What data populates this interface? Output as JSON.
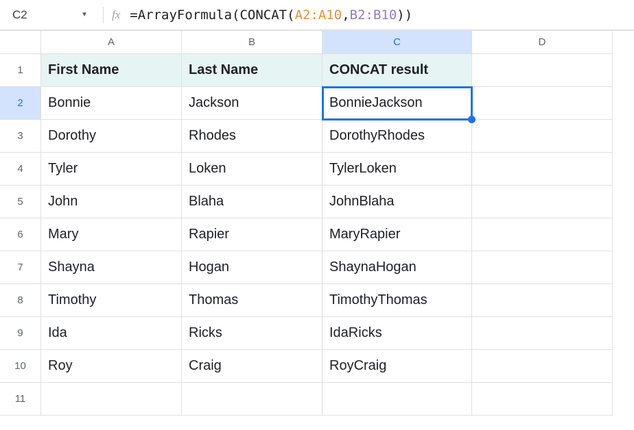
{
  "nameBox": {
    "value": "C2",
    "dropdownGlyph": "▼"
  },
  "fxLabel": "fx",
  "formula": {
    "eq": "=",
    "fn1": "ArrayFormula",
    "open1": "(",
    "fn2": "CONCAT",
    "open2": "(",
    "ref1": "A2:A10",
    "comma": ",",
    "ref2": "B2:B10",
    "close2": ")",
    "close1": ")"
  },
  "columns": [
    "A",
    "B",
    "C",
    "D"
  ],
  "rowNumbers": [
    "1",
    "2",
    "3",
    "4",
    "5",
    "6",
    "7",
    "8",
    "9",
    "10",
    "11"
  ],
  "selected": {
    "col": "C",
    "row": "2"
  },
  "headers": {
    "A": "First Name",
    "B": "Last Name",
    "C": "CONCAT result"
  },
  "rows": [
    {
      "A": "Bonnie",
      "B": "Jackson",
      "C": "BonnieJackson"
    },
    {
      "A": "Dorothy",
      "B": "Rhodes",
      "C": "DorothyRhodes"
    },
    {
      "A": "Tyler",
      "B": "Loken",
      "C": "TylerLoken"
    },
    {
      "A": "John",
      "B": "Blaha",
      "C": "JohnBlaha"
    },
    {
      "A": "Mary",
      "B": "Rapier",
      "C": "MaryRapier"
    },
    {
      "A": "Shayna",
      "B": "Hogan",
      "C": "ShaynaHogan"
    },
    {
      "A": "Timothy",
      "B": "Thomas",
      "C": "TimothyThomas"
    },
    {
      "A": "Ida",
      "B": "Ricks",
      "C": "IdaRicks"
    },
    {
      "A": "Roy",
      "B": "Craig",
      "C": "RoyCraig"
    }
  ]
}
